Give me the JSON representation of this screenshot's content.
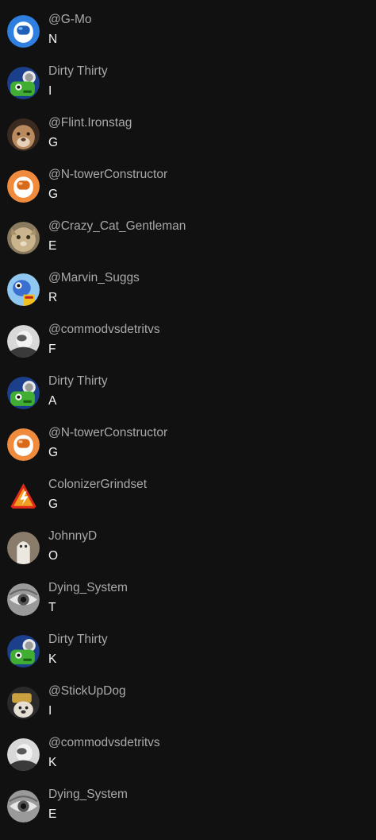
{
  "colors": {
    "background": "#111111",
    "username": "#a9a9a9",
    "message": "#f4f4f4"
  },
  "messages": [
    {
      "user": "@G-Mo",
      "text": "N",
      "avatar": "astronaut-blue-avatar-icon"
    },
    {
      "user": "Dirty Thirty",
      "text": "I",
      "avatar": "green-cartoon-avatar-icon"
    },
    {
      "user": "@Flint.Ironstag",
      "text": "G",
      "avatar": "cougar-photo-avatar-icon"
    },
    {
      "user": "@N-towerConstructor",
      "text": "G",
      "avatar": "astronaut-orange-avatar-icon"
    },
    {
      "user": "@Crazy_Cat_Gentleman",
      "text": "E",
      "avatar": "cat-photo-avatar-icon"
    },
    {
      "user": "@Marvin_Suggs",
      "text": "R",
      "avatar": "cartoon-character-avatar-icon"
    },
    {
      "user": "@commodvsdetritvs",
      "text": "F",
      "avatar": "bw-figure-avatar-icon"
    },
    {
      "user": "Dirty Thirty",
      "text": "A",
      "avatar": "green-cartoon-avatar-icon"
    },
    {
      "user": "@N-towerConstructor",
      "text": "G",
      "avatar": "astronaut-orange-avatar-icon"
    },
    {
      "user": "ColonizerGrindset",
      "text": "G",
      "avatar": "warning-triangle-avatar-icon"
    },
    {
      "user": "JohnnyD",
      "text": "O",
      "avatar": "ghost-photo-avatar-icon"
    },
    {
      "user": "Dying_System",
      "text": "T",
      "avatar": "eye-avatar-icon"
    },
    {
      "user": "Dirty Thirty",
      "text": "K",
      "avatar": "green-cartoon-avatar-icon"
    },
    {
      "user": "@StickUpDog",
      "text": "I",
      "avatar": "dog-photo-avatar-icon"
    },
    {
      "user": "@commodvsdetritvs",
      "text": "K",
      "avatar": "bw-figure-avatar-icon"
    },
    {
      "user": "Dying_System",
      "text": "E",
      "avatar": "eye-avatar-icon"
    }
  ]
}
